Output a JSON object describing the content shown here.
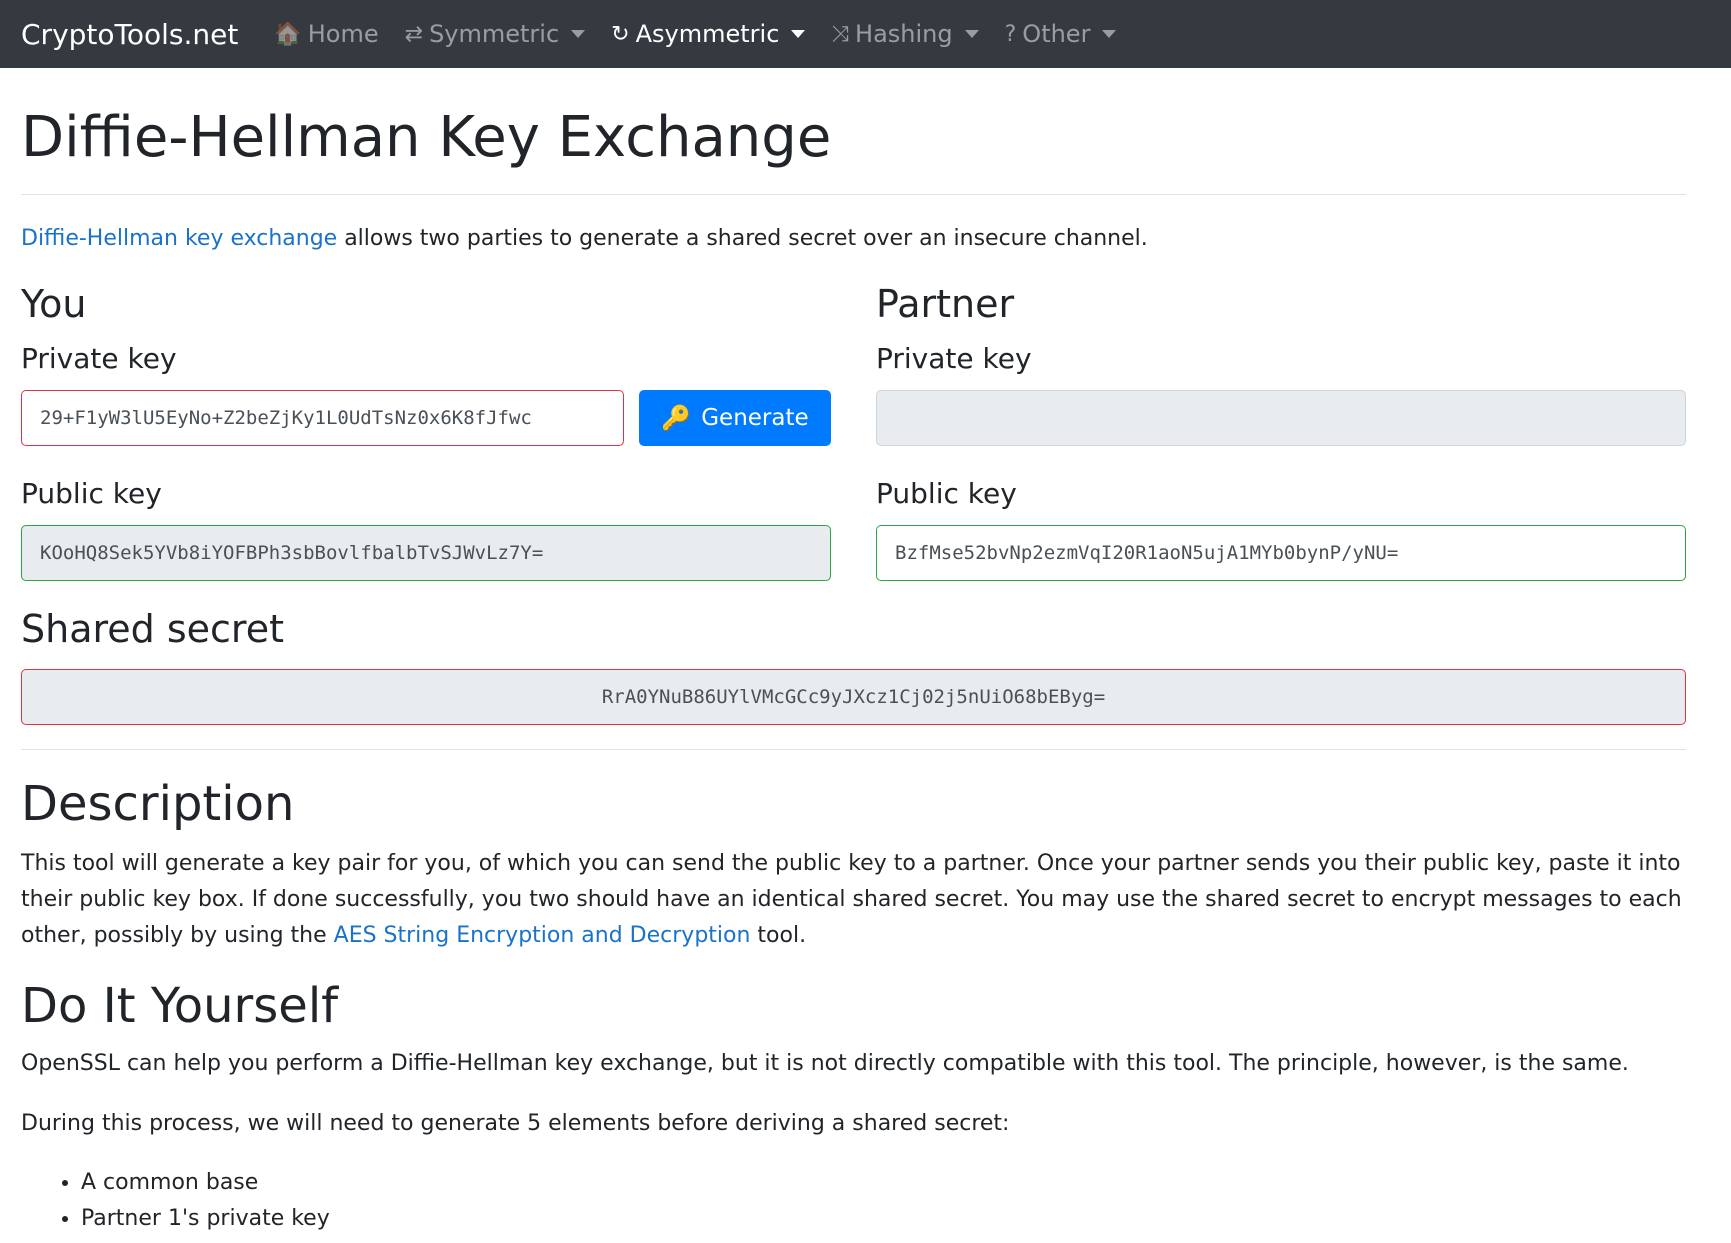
{
  "navbar": {
    "brand": "CryptoTools.net",
    "items": [
      {
        "icon": "home-icon",
        "glyph": "🏠",
        "label": "Home",
        "dropdown": false,
        "active": false
      },
      {
        "icon": "arrows-exchange-icon",
        "glyph": "⇄",
        "label": "Symmetric",
        "dropdown": true,
        "active": false
      },
      {
        "icon": "refresh-icon",
        "glyph": "↻",
        "label": "Asymmetric",
        "dropdown": true,
        "active": true
      },
      {
        "icon": "shuffle-icon",
        "glyph": "⤨",
        "label": "Hashing",
        "dropdown": true,
        "active": false
      },
      {
        "icon": "question-icon",
        "glyph": "?",
        "label": "Other",
        "dropdown": true,
        "active": false
      }
    ]
  },
  "page": {
    "title": "Diffie-Hellman Key Exchange",
    "intro_link": "Diffie-Hellman key exchange",
    "intro_rest": " allows two parties to generate a shared secret over an insecure channel."
  },
  "you": {
    "heading": "You",
    "private_key_label": "Private key",
    "private_key_value": "29+F1yW3lU5EyNo+Z2beZjKy1L0UdTsNz0x6K8fJfwc",
    "generate_label": "Generate",
    "public_key_label": "Public key",
    "public_key_value": "KOoHQ8Sek5YVb8iYOFBPh3sbBovlfbalbTvSJWvLz7Y="
  },
  "partner": {
    "heading": "Partner",
    "private_key_label": "Private key",
    "private_key_value": "",
    "public_key_label": "Public key",
    "public_key_value": "BzfMse52bvNp2ezmVqI20R1aoN5ujA1MYb0bynP/yNU="
  },
  "shared": {
    "heading": "Shared secret",
    "value": "RrA0YNuB86UYlVMcGCc9yJXcz1Cj02j5nUiO68bEByg="
  },
  "description": {
    "heading": "Description",
    "text_before": "This tool will generate a key pair for you, of which you can send the public key to a partner. Once your partner sends you their public key, paste it into their public key box. If done successfully, you two should have an identical shared secret. You may use the shared secret to encrypt messages to each other, possibly by using the ",
    "link": "AES String Encryption and Decryption",
    "text_after": " tool."
  },
  "diy": {
    "heading": "Do It Yourself",
    "para1": "OpenSSL can help you perform a Diffie-Hellman key exchange, but it is not directly compatible with this tool. The principle, however, is the same.",
    "para2": "During this process, we will need to generate 5 elements before deriving a shared secret:",
    "items": [
      "A common base",
      "Partner 1's private key"
    ]
  },
  "colors": {
    "navbar_bg": "#343a40",
    "primary": "#007bff",
    "link": "#1a73c9",
    "invalid_border": "#dc3545",
    "valid_border": "#28a745",
    "readonly_bg": "#e9ecef"
  }
}
